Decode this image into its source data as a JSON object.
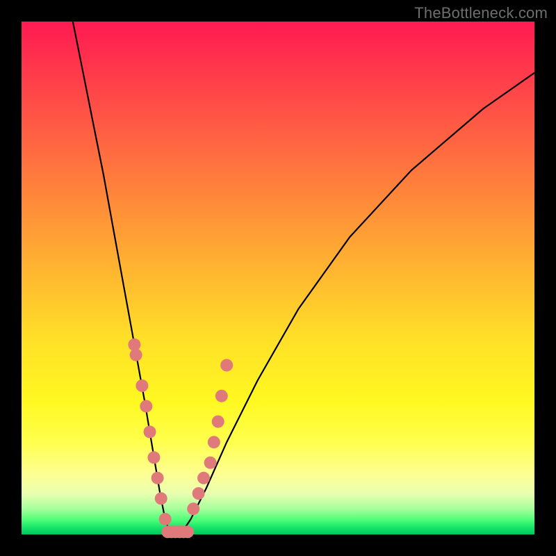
{
  "watermark": "TheBottleneck.com",
  "chart_data": {
    "type": "line",
    "title": "",
    "xlabel": "",
    "ylabel": "",
    "xlim": [
      0,
      100
    ],
    "ylim": [
      0,
      100
    ],
    "curve": {
      "name": "bottleneck-curve",
      "x": [
        10,
        12,
        14,
        16,
        18,
        20,
        22,
        24,
        26,
        27,
        28,
        29,
        30,
        31,
        33,
        36,
        40,
        46,
        54,
        64,
        76,
        90,
        100
      ],
      "y": [
        100,
        90,
        80,
        70,
        59,
        48,
        37,
        26,
        14,
        8,
        3,
        0,
        0,
        0,
        3,
        9,
        18,
        30,
        44,
        58,
        71,
        83,
        90
      ]
    },
    "markers_left": {
      "name": "sample-points-left",
      "x": [
        22.0,
        22.3,
        23.5,
        24.3,
        25.0,
        25.8,
        26.5,
        27.2,
        28.0
      ],
      "y": [
        37,
        35,
        29,
        25,
        20,
        15,
        11,
        7,
        3
      ]
    },
    "markers_right": {
      "name": "sample-points-right",
      "x": [
        33.5,
        34.5,
        35.5,
        36.8,
        37.5,
        38.3,
        39.0,
        40.0
      ],
      "y": [
        5,
        8,
        11,
        14,
        18,
        22,
        27,
        33
      ]
    },
    "markers_bottom": {
      "name": "sample-points-bottom",
      "x": [
        28.5,
        29.2,
        30.0,
        30.8,
        31.6,
        32.4
      ],
      "y": [
        0.5,
        0.5,
        0.5,
        0.5,
        0.5,
        0.5
      ]
    },
    "gradient_stops": [
      {
        "pct": 0,
        "color": "#ff1a52"
      },
      {
        "pct": 50,
        "color": "#ffba2f"
      },
      {
        "pct": 82,
        "color": "#ffff4e"
      },
      {
        "pct": 100,
        "color": "#00c85c"
      }
    ]
  }
}
